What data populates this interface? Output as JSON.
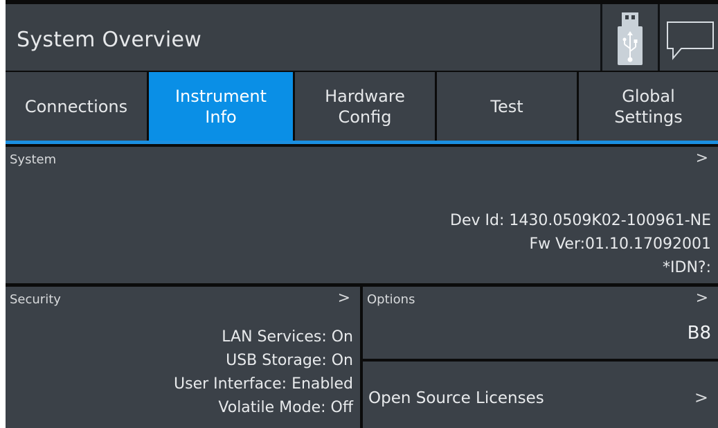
{
  "header": {
    "title": "System Overview",
    "usb_icon": "usb-stick-icon",
    "message_icon": "speech-bubble-icon"
  },
  "tabs": [
    {
      "label": "Connections",
      "active": false
    },
    {
      "label": "Instrument\nInfo",
      "active": true
    },
    {
      "label": "Hardware\nConfig",
      "active": false
    },
    {
      "label": "Test",
      "active": false
    },
    {
      "label": "Global\nSettings",
      "active": false
    }
  ],
  "system": {
    "heading": "System",
    "chevron": ">",
    "dev_id": "Dev Id: 1430.0509K02-100961-NE",
    "fw_ver": "Fw Ver:01.10.17092001",
    "idn": "*IDN?:"
  },
  "security": {
    "heading": "Security",
    "chevron": ">",
    "lan": "LAN Services: On",
    "usb": "USB Storage: On",
    "ui": "User Interface: Enabled",
    "volatile": "Volatile Mode: Off"
  },
  "options": {
    "heading": "Options",
    "chevron": ">",
    "value": "B8"
  },
  "oss": {
    "label": "Open Source Licenses",
    "chevron": ">"
  },
  "colors": {
    "accent": "#0a8fe6",
    "panel": "#3b4148",
    "background": "#0b0b0b"
  }
}
